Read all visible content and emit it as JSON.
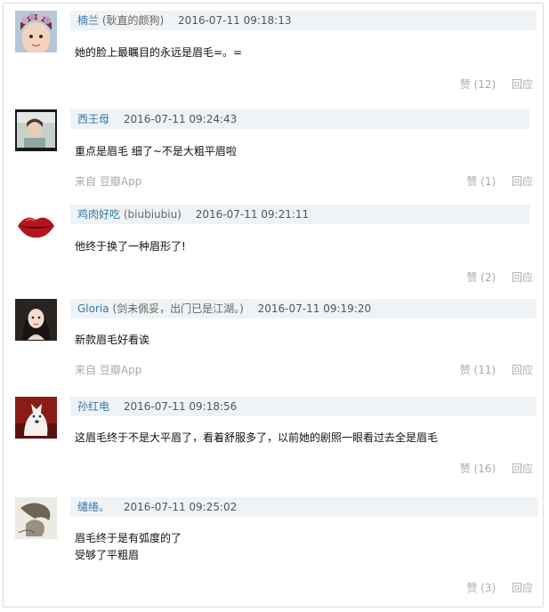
{
  "comments": [
    {
      "author": "楠兰",
      "note": "(耿直的颜狗)",
      "time": "2016-07-11 09:18:13",
      "lines": [
        "她的脸上最瞩目的永远是眉毛=。="
      ],
      "source": "",
      "likes": "赞 (12)",
      "reply": "回应",
      "avatar_icon": "girl-flower-crown-avatar"
    },
    {
      "author": "西王母",
      "note": "",
      "time": "2016-07-11 09:24:43",
      "lines": [
        "重点是眉毛 细了~不是大粗平眉啦"
      ],
      "source": "来自 豆瓣App",
      "likes": "赞 (1)",
      "reply": "回应",
      "avatar_icon": "woman-photo-avatar"
    },
    {
      "author": "鸡肉好吃",
      "note": "(biubiubiu)",
      "time": "2016-07-11 09:21:11",
      "lines": [
        "他终于换了一种眉形了!"
      ],
      "source": "",
      "likes": "赞 (2)",
      "reply": "回应",
      "avatar_icon": "red-lips-avatar"
    },
    {
      "author": "Gloria",
      "note": "(剑未佩妥，出门已是江湖。)",
      "time": "2016-07-11 09:19:20",
      "lines": [
        "新款眉毛好看诶"
      ],
      "source": "来自 豆瓣App",
      "likes": "赞 (11)",
      "reply": "回应",
      "avatar_icon": "girl-portrait-avatar"
    },
    {
      "author": "孙红电",
      "note": "",
      "time": "2016-07-11 09:18:56",
      "lines": [
        "这眉毛终于不是大平眉了，看着舒服多了，以前她的剧照一眼看过去全是眉毛"
      ],
      "source": "",
      "likes": "赞 (16)",
      "reply": "回应",
      "avatar_icon": "white-dog-avatar"
    },
    {
      "author": "缱绻。",
      "note": "",
      "time": "2016-07-11 09:25:02",
      "lines": [
        "眉毛终于是有弧度的了",
        "受够了平粗眉"
      ],
      "source": "",
      "likes": "赞 (3)",
      "reply": "回应",
      "avatar_icon": "sketch-avatar"
    }
  ]
}
